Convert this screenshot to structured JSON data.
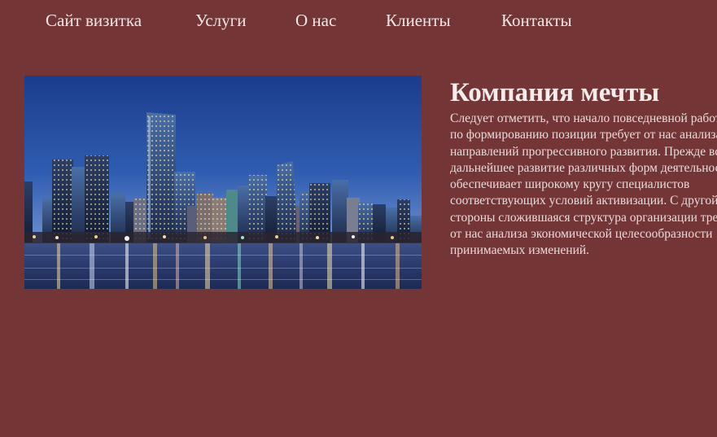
{
  "nav": {
    "items": [
      {
        "label": "Сайт визитка"
      },
      {
        "label": "Услуги"
      },
      {
        "label": "О нас"
      },
      {
        "label": "Клиенты"
      },
      {
        "label": "Контакты"
      }
    ]
  },
  "main": {
    "title": "Компания мечты",
    "paragraph": "Следует отметить, что начало повседневной работы по формированию позиции требует от нас анализа направлений прогрессивного развития. Прежде всего дальнейшее развитие различных форм деятельности обеспечивает широкому кругу специалистов соответствующих условий активизации. С другой стороны сложившаяся структура организации требует от нас анализа экономической целесообразности принимаемых изменений."
  },
  "colors": {
    "page_background": "#733536",
    "text": "#f4eaea"
  },
  "image": {
    "semantic": "city-skyline-night-photo"
  }
}
